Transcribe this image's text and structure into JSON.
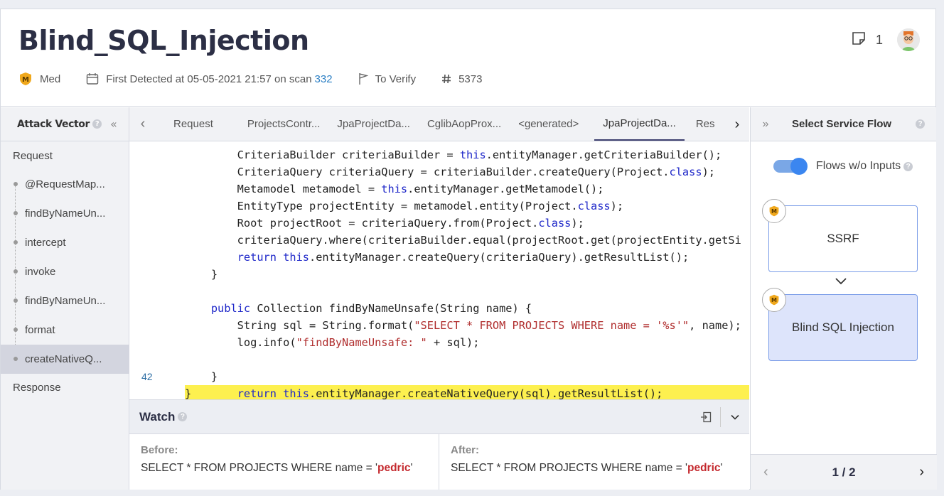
{
  "header": {
    "title": "Blind_SQL_Injection",
    "severity": "Med",
    "first_detected": "First Detected at 05-05-2021 21:57 on scan",
    "scan_id": "332",
    "state": "To Verify",
    "id_value": "5373",
    "notes_count": "1"
  },
  "attack_vector": {
    "title": "Attack Vector",
    "top": "Request",
    "items": [
      {
        "label": "@RequestMap..."
      },
      {
        "label": "findByNameUn..."
      },
      {
        "label": "intercept"
      },
      {
        "label": "invoke"
      },
      {
        "label": "findByNameUn..."
      },
      {
        "label": "format"
      },
      {
        "label": "createNativeQ..."
      }
    ],
    "bottom": "Response",
    "active_index": 6
  },
  "tabs": {
    "items": [
      "Request",
      "ProjectsContr...",
      "JpaProjectDa...",
      "CglibAopProx...",
      "<generated>",
      "JpaProjectDa...",
      "Res"
    ],
    "active_index": 5
  },
  "code": {
    "highlight_line_number": "42",
    "lines": [
      "        CriteriaBuilder criteriaBuilder = this.entityManager.getCriteriaBuilder();",
      "        CriteriaQuery criteriaQuery = criteriaBuilder.createQuery(Project.class);",
      "        Metamodel metamodel = this.entityManager.getMetamodel();",
      "        EntityType projectEntity = metamodel.entity(Project.class);",
      "        Root projectRoot = criteriaQuery.from(Project.class);",
      "        criteriaQuery.where(criteriaBuilder.equal(projectRoot.get(projectEntity.getSi",
      "        return this.entityManager.createQuery(criteriaQuery).getResultList();",
      "    }",
      "",
      "    public Collection findByNameUnsafe(String name) {",
      "        String sql = String.format(\"SELECT * FROM PROJECTS WHERE name = '%s'\", name);",
      "        log.info(\"findByNameUnsafe: \" + sql);",
      "        return this.entityManager.createNativeQuery(sql).getResultList();",
      "    }",
      "}"
    ]
  },
  "watch": {
    "title": "Watch",
    "before_label": "Before:",
    "after_label": "After:",
    "before_prefix": "SELECT * FROM PROJECTS WHERE name = '",
    "before_value": "pedric",
    "before_suffix": "'",
    "after_prefix": "SELECT * FROM PROJECTS WHERE name = '",
    "after_value": "pedric",
    "after_suffix": "'"
  },
  "service_flow": {
    "title": "Select Service Flow",
    "toggle_label": "Flows w/o Inputs",
    "toggle_on": true,
    "cards": [
      "SSRF",
      "Blind SQL Injection"
    ],
    "pager": "1 / 2"
  },
  "colors": {
    "accent": "#3d3f6f",
    "highlight": "#fdf04f",
    "value_red": "#c4282d",
    "link": "#2b7fc4"
  }
}
